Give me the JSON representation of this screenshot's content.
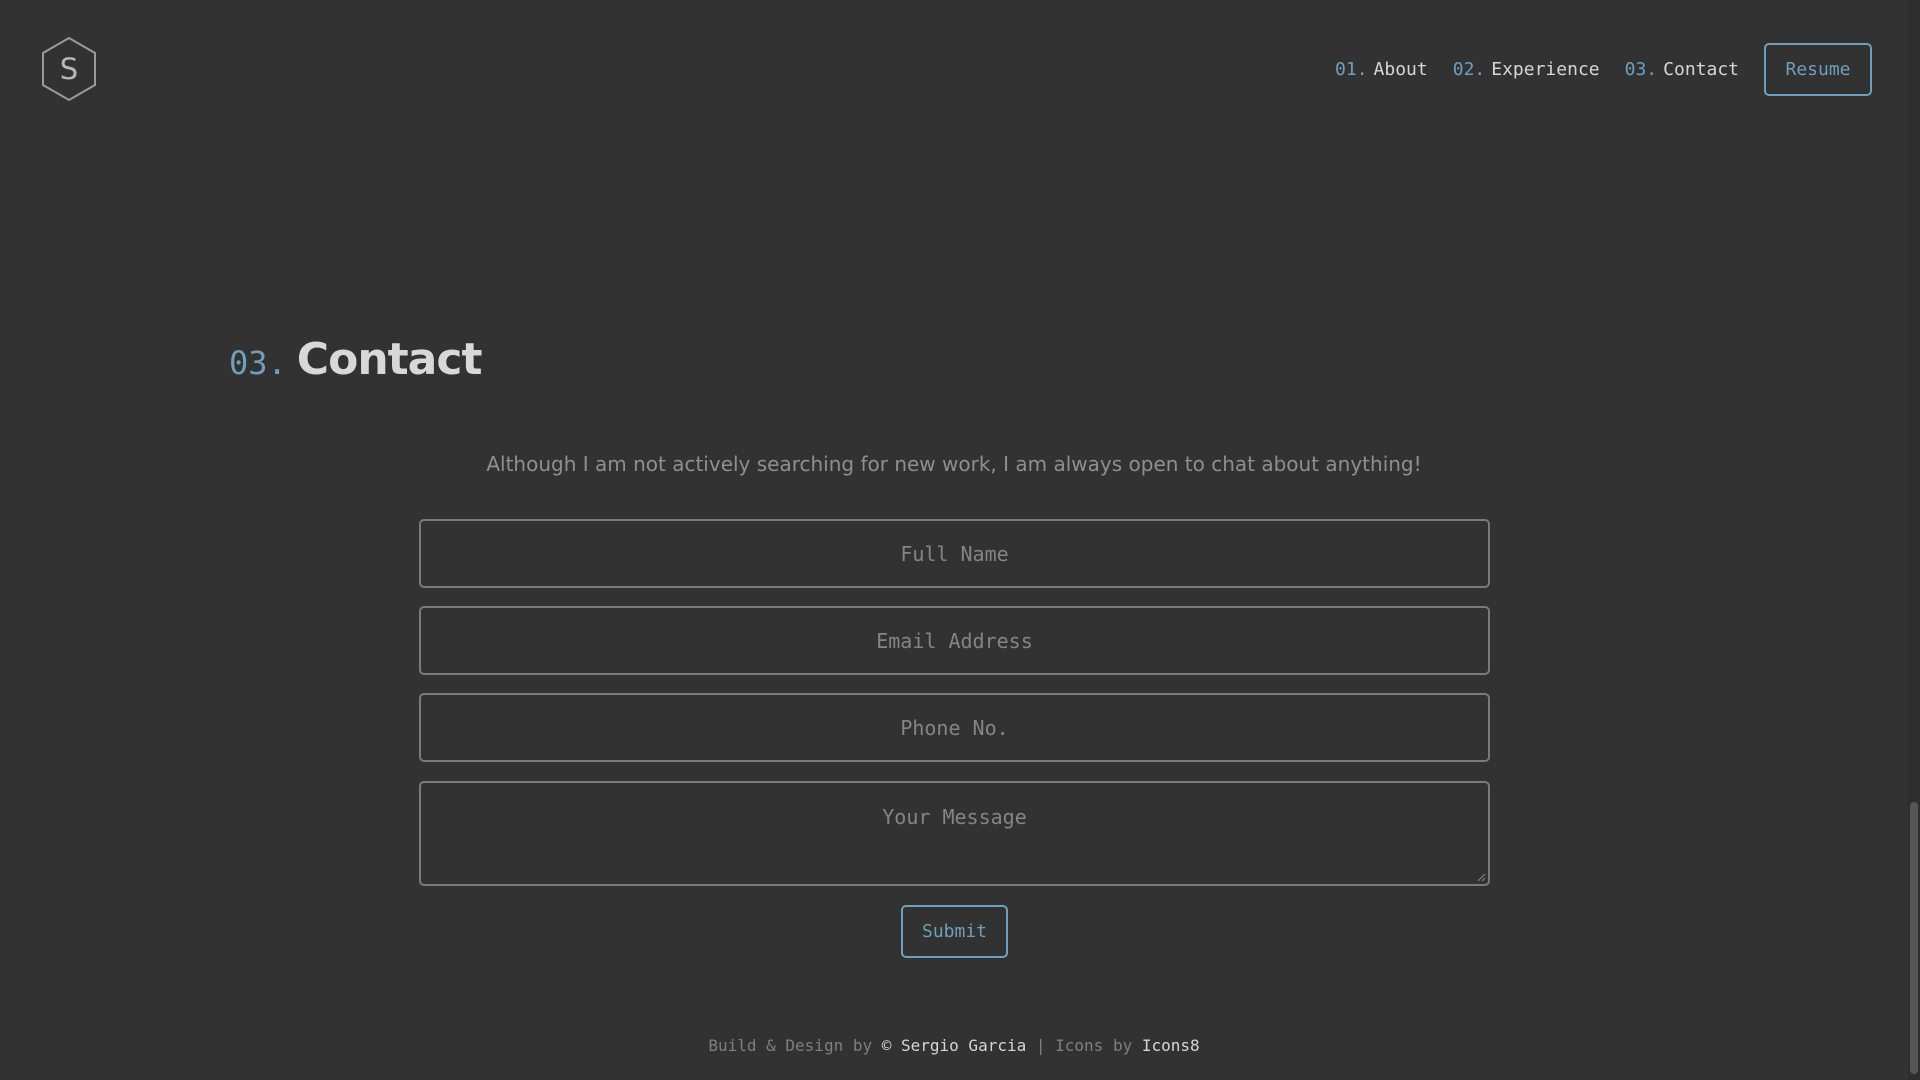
{
  "header": {
    "logo_letter": "S",
    "nav": [
      {
        "num": "01.",
        "label": "About"
      },
      {
        "num": "02.",
        "label": "Experience"
      },
      {
        "num": "03.",
        "label": "Contact"
      }
    ],
    "resume_label": "Resume"
  },
  "section": {
    "num": "03.",
    "title": "Contact",
    "intro": "Although I am not actively searching for new work, I am always open to chat about anything!"
  },
  "form": {
    "name_placeholder": "Full Name",
    "email_placeholder": "Email Address",
    "phone_placeholder": "Phone No.",
    "message_placeholder": "Your Message",
    "submit_label": "Submit"
  },
  "footer": {
    "prefix": "Build & Design by ",
    "author": "© Sergio Garcia",
    "separator": " | ",
    "icons_prefix": "Icons by ",
    "icons_credit": "Icons8"
  },
  "colors": {
    "background": "#323232",
    "accent": "#6e9fbd",
    "text": "#d6d6d6",
    "muted": "#8f8f8f"
  },
  "icons": {
    "logo": "hexagon-logo-icon",
    "resize": "resize-grip-icon"
  }
}
